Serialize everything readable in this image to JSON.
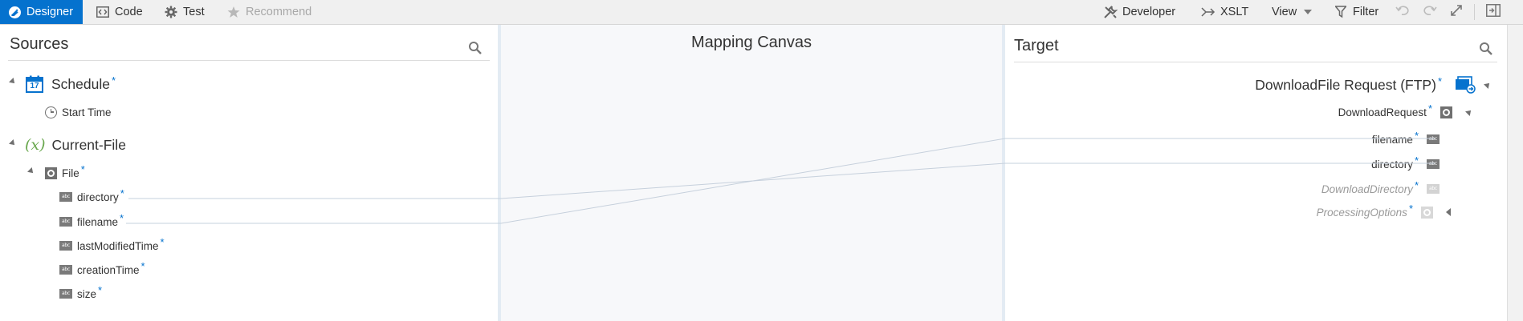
{
  "toolbar": {
    "tabs": [
      {
        "label": "Designer",
        "icon": "designer-icon",
        "active": true
      },
      {
        "label": "Code",
        "icon": "code-icon",
        "active": false
      },
      {
        "label": "Test",
        "icon": "gear-icon",
        "active": false
      },
      {
        "label": "Recommend",
        "icon": "star-icon",
        "active": false,
        "disabled": true
      }
    ],
    "right": {
      "developer": "Developer",
      "xslt": "XSLT",
      "view": "View",
      "filter": "Filter"
    }
  },
  "sources": {
    "title": "Sources",
    "schedule": {
      "label": "Schedule",
      "required": "*",
      "calendar_day": "17"
    },
    "start_time": {
      "label": "Start Time"
    },
    "current_file": {
      "label": "Current-File",
      "icon_text": "(x)"
    },
    "file": {
      "label": "File",
      "required": "*"
    },
    "fields": [
      {
        "label": "directory",
        "required": "*"
      },
      {
        "label": "filename",
        "required": "*"
      },
      {
        "label": "lastModifiedTime",
        "required": "*"
      },
      {
        "label": "creationTime",
        "required": "*"
      },
      {
        "label": "size",
        "required": "*"
      }
    ],
    "type_badge": "abc"
  },
  "canvas": {
    "title": "Mapping Canvas"
  },
  "target": {
    "title": "Target",
    "root": {
      "label": "DownloadFile Request (FTP)",
      "required": "*"
    },
    "download_request": {
      "label": "DownloadRequest",
      "required": "*"
    },
    "fields": [
      {
        "label": "filename",
        "required": "*"
      },
      {
        "label": "directory",
        "required": "*"
      },
      {
        "label": "DownloadDirectory",
        "required": "*"
      },
      {
        "label": "ProcessingOptions",
        "required": "*"
      }
    ]
  },
  "colors": {
    "accent": "#0572ce",
    "required": "#0572ce",
    "toolbar_bg": "#f0f0f0",
    "canvas_bg": "#f7f8fa",
    "variable_green": "#6aa84f"
  }
}
